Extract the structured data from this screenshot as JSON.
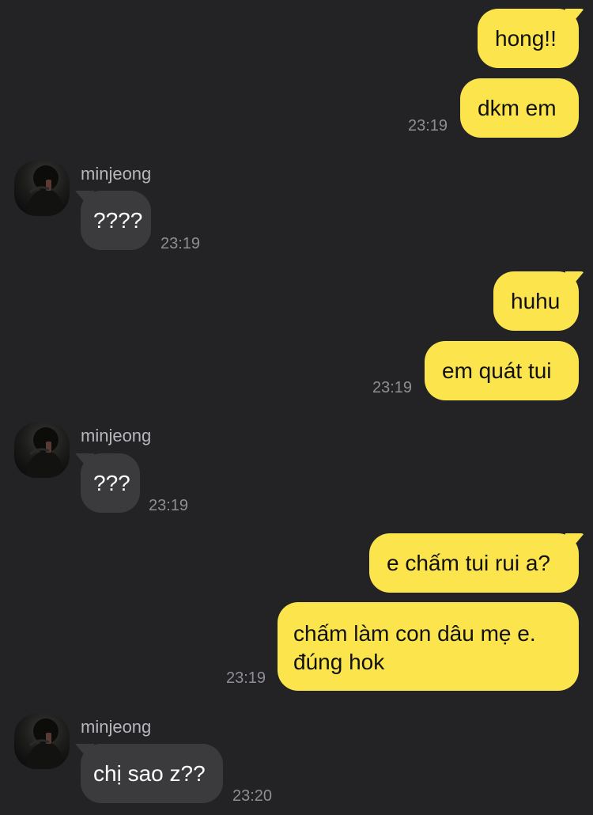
{
  "messages": [
    {
      "side": "out",
      "text": "hong!!"
    },
    {
      "side": "out",
      "text": "dkm em",
      "time": "23:19"
    },
    {
      "side": "in",
      "sender": "minjeong",
      "text": "????",
      "time": "23:19"
    },
    {
      "side": "out",
      "text": "huhu"
    },
    {
      "side": "out",
      "text": "em quát tui",
      "time": "23:19"
    },
    {
      "side": "in",
      "sender": "minjeong",
      "text": "???",
      "time": "23:19"
    },
    {
      "side": "out",
      "text": "e chấm tui rui a?"
    },
    {
      "side": "out",
      "text": "chấm làm con dâu mẹ e.\nđúng hok",
      "text_line1": "chấm làm con dâu mẹ e.",
      "text_line2": "đúng hok",
      "time": "23:19"
    },
    {
      "side": "in",
      "sender": "minjeong",
      "text": "chị sao z??",
      "time": "23:20"
    }
  ],
  "colors": {
    "background": "#232325",
    "outgoing_bubble": "#fbe44c",
    "incoming_bubble": "#3b3b3e",
    "timestamp": "#8e8e93"
  }
}
